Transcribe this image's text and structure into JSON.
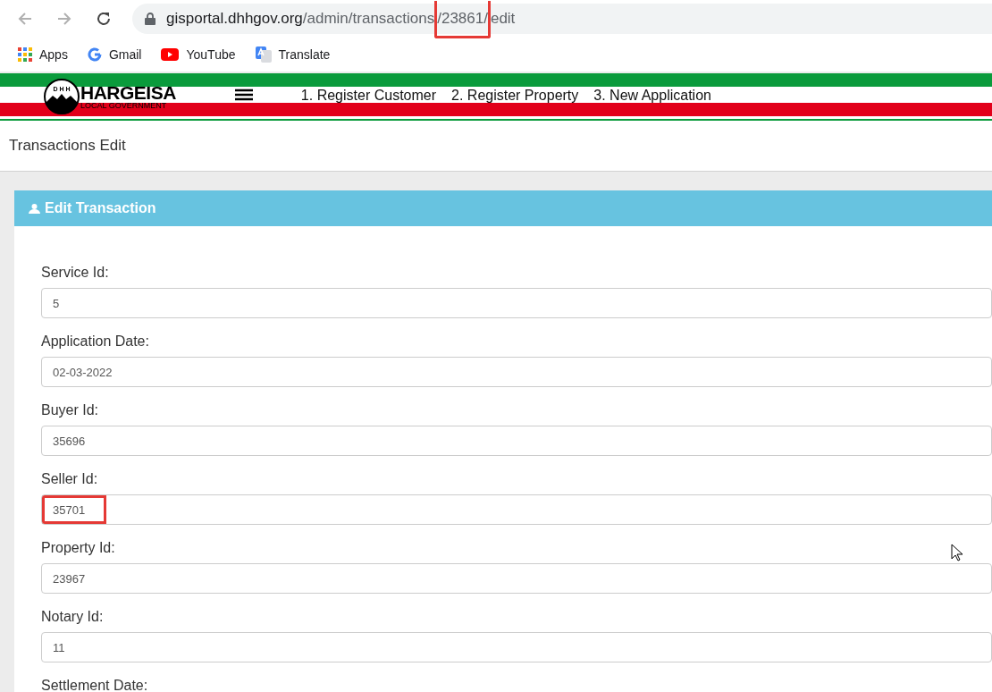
{
  "browser": {
    "url": [
      {
        "text": "gisportal.dhhgov.org",
        "kind": "host",
        "highlighted": false
      },
      {
        "text": "/admin/transactions",
        "kind": "path",
        "highlighted": false
      },
      {
        "text": "/23861/",
        "kind": "path",
        "highlighted": true
      },
      {
        "text": "edit",
        "kind": "path",
        "highlighted": false
      }
    ],
    "bookmarks": [
      {
        "label": "Apps",
        "kind": "apps"
      },
      {
        "label": "Gmail",
        "kind": "gmail"
      },
      {
        "label": "YouTube",
        "kind": "youtube"
      },
      {
        "label": "Translate",
        "kind": "translate"
      }
    ]
  },
  "header": {
    "logo_title": "HARGEISA",
    "logo_subtitle": "LOCAL GOVERNMENT",
    "logo_letters": "D H H",
    "nav": [
      "1. Register Customer",
      "2. Register Property",
      "3. New Application"
    ]
  },
  "page_title": "Transactions Edit",
  "card": {
    "title": "Edit Transaction",
    "fields": [
      {
        "label": "Service Id:",
        "value": "5",
        "highlighted": false
      },
      {
        "label": "Application Date:",
        "value": "02-03-2022",
        "highlighted": false
      },
      {
        "label": "Buyer Id:",
        "value": "35696",
        "highlighted": false
      },
      {
        "label": "Seller Id:",
        "value": "35701",
        "highlighted": true
      },
      {
        "label": "Property Id:",
        "value": "23967",
        "highlighted": false
      },
      {
        "label": "Notary Id:",
        "value": "11",
        "highlighted": false
      }
    ],
    "next_label": "Settlement Date:"
  }
}
